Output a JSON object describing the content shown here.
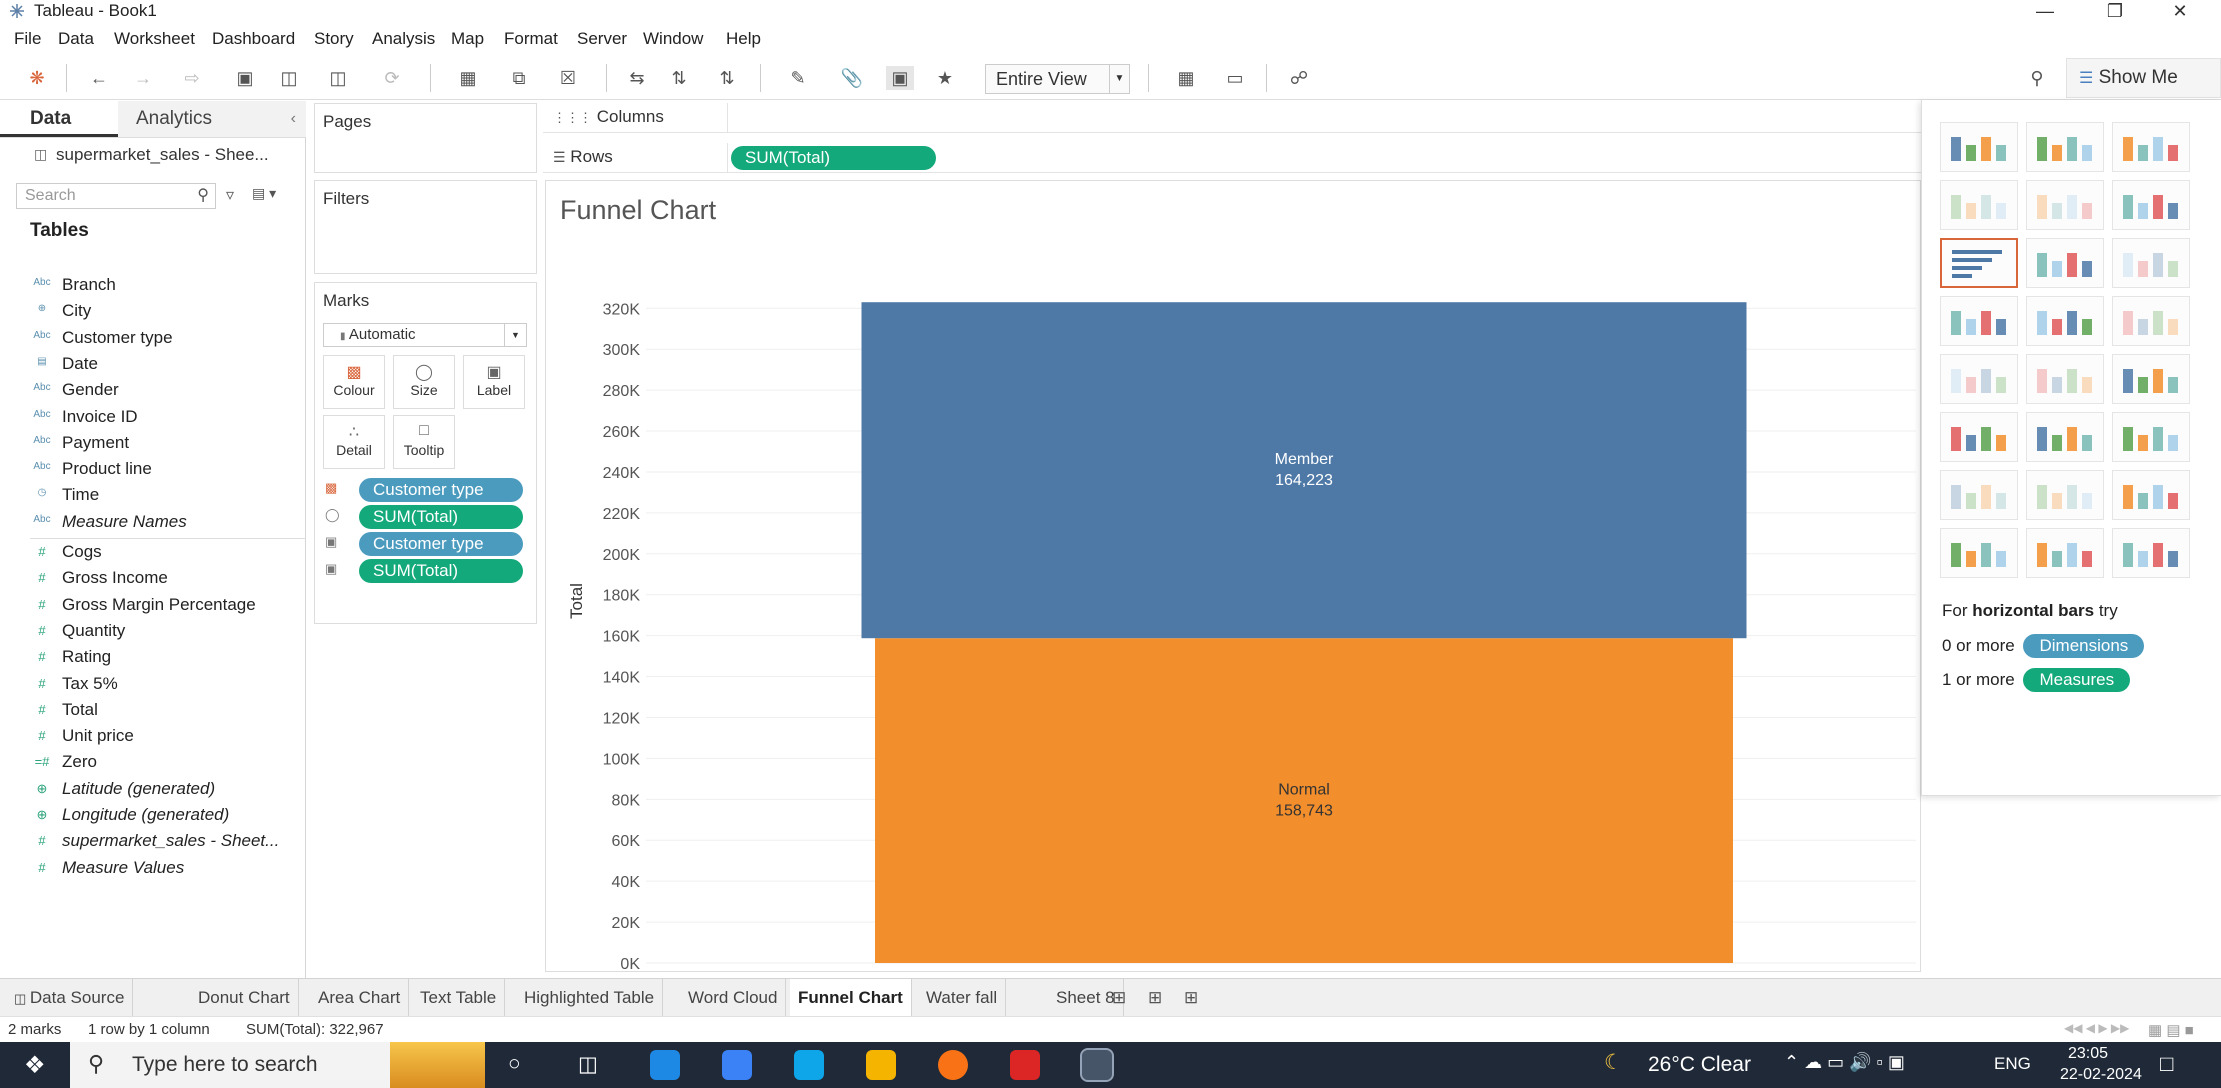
{
  "window": {
    "title": "Tableau - Book1"
  },
  "menu": [
    "File",
    "Data",
    "Worksheet",
    "Dashboard",
    "Story",
    "Analysis",
    "Map",
    "Format",
    "Server",
    "Window",
    "Help"
  ],
  "toolbar": {
    "view_mode": "Entire View",
    "show_me_label": "Show Me"
  },
  "left_pane": {
    "tab_data": "Data",
    "tab_analytics": "Analytics",
    "data_source": "supermarket_sales - Shee...",
    "search_placeholder": "Search",
    "tables_heading": "Tables",
    "dimensions": [
      {
        "name": "Branch",
        "icon": "Abc"
      },
      {
        "name": "City",
        "icon": "globe"
      },
      {
        "name": "Customer type",
        "icon": "Abc"
      },
      {
        "name": "Date",
        "icon": "calendar"
      },
      {
        "name": "Gender",
        "icon": "Abc"
      },
      {
        "name": "Invoice ID",
        "icon": "Abc"
      },
      {
        "name": "Payment",
        "icon": "Abc"
      },
      {
        "name": "Product line",
        "icon": "Abc"
      },
      {
        "name": "Time",
        "icon": "calendar-clock"
      },
      {
        "name": "Measure Names",
        "icon": "Abc",
        "italic": true
      }
    ],
    "measures": [
      {
        "name": "Cogs",
        "icon": "#"
      },
      {
        "name": "Gross Income",
        "icon": "#"
      },
      {
        "name": "Gross Margin Percentage",
        "icon": "#"
      },
      {
        "name": "Quantity",
        "icon": "#"
      },
      {
        "name": "Rating",
        "icon": "#"
      },
      {
        "name": "Tax 5%",
        "icon": "#"
      },
      {
        "name": "Total",
        "icon": "#"
      },
      {
        "name": "Unit price",
        "icon": "#"
      },
      {
        "name": "Zero",
        "icon": "=#"
      },
      {
        "name": "Latitude (generated)",
        "icon": "globe",
        "italic": true
      },
      {
        "name": "Longitude (generated)",
        "icon": "globe",
        "italic": true
      },
      {
        "name": "supermarket_sales - Sheet...",
        "icon": "#",
        "italic": true
      },
      {
        "name": "Measure Values",
        "icon": "#",
        "italic": true
      }
    ]
  },
  "pages": {
    "label": "Pages"
  },
  "filters": {
    "label": "Filters"
  },
  "marks": {
    "label": "Marks",
    "type": "Automatic",
    "buttons": [
      "Colour",
      "Size",
      "Label",
      "Detail",
      "Tooltip"
    ],
    "pills": [
      {
        "label": "Customer type",
        "kind": "dim",
        "icon": "colour"
      },
      {
        "label": "SUM(Total)",
        "kind": "mea",
        "icon": "size"
      },
      {
        "label": "Customer type",
        "kind": "dim",
        "icon": "label"
      },
      {
        "label": "SUM(Total)",
        "kind": "mea",
        "icon": "label"
      }
    ]
  },
  "shelves": {
    "columns_label": "Columns",
    "rows_label": "Rows",
    "rows_pill": "SUM(Total)"
  },
  "worksheet": {
    "title": "Funnel Chart"
  },
  "chart_data": {
    "type": "bar",
    "title": "Funnel Chart",
    "ylabel": "Total",
    "stacked": true,
    "ylim": [
      0,
      320000
    ],
    "yticks": [
      "0K",
      "20K",
      "40K",
      "60K",
      "80K",
      "100K",
      "120K",
      "140K",
      "160K",
      "180K",
      "200K",
      "220K",
      "240K",
      "260K",
      "280K",
      "300K",
      "320K"
    ],
    "series": [
      {
        "name": "Normal",
        "value": 158743,
        "label": "158,743",
        "color": "#f28e2b"
      },
      {
        "name": "Member",
        "value": 164223,
        "label": "164,223",
        "color": "#4e79a7"
      }
    ]
  },
  "show_me": {
    "hint_prefix": "For ",
    "hint_bold": "horizontal bars",
    "hint_suffix": " try",
    "req1_prefix": "0 or more",
    "req1_pill": "Dimensions",
    "req2_prefix": "1 or more",
    "req2_pill": "Measures"
  },
  "sheet_tabs": [
    "Data Source",
    "Donut Chart",
    "Area Chart",
    "Text Table",
    "Highlighted Table",
    "Word Cloud",
    "Funnel Chart",
    "Water fall",
    "Sheet 8"
  ],
  "active_tab": "Funnel Chart",
  "status": {
    "marks": "2 marks",
    "rows": "1 row by 1 column",
    "sum": "SUM(Total): 322,967"
  },
  "taskbar": {
    "search_placeholder": "Type here to search",
    "weather": "26°C  Clear",
    "lang": "ENG",
    "time": "23:05",
    "date": "22-02-2024"
  },
  "colors": {
    "member": "#4e79a7",
    "normal": "#f28e2b",
    "dim_pill": "#4b9bbf",
    "mea_pill": "#14a97a"
  }
}
